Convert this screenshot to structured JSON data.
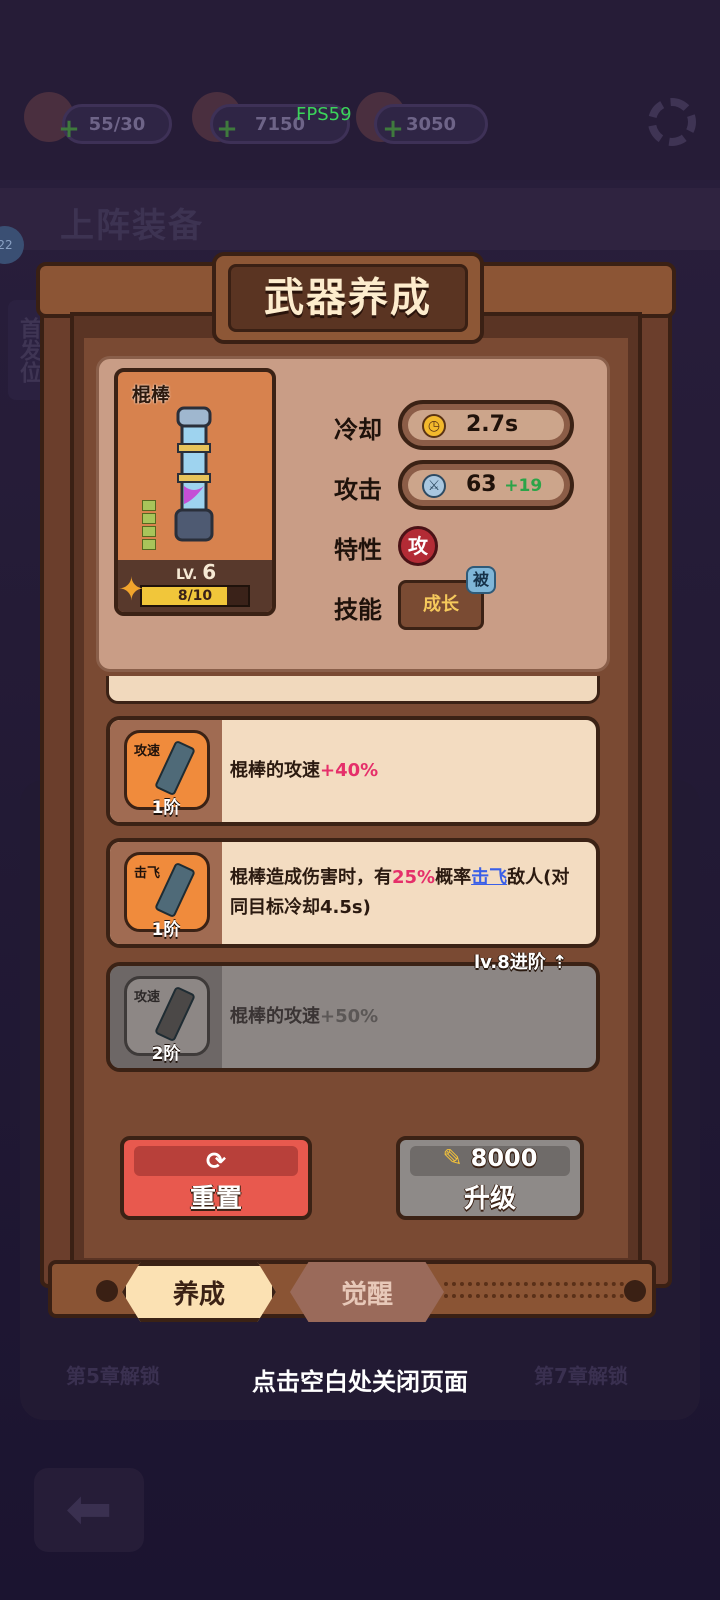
{
  "background": {
    "resources": [
      {
        "name": "energy",
        "value": "55/30"
      },
      {
        "name": "gold",
        "value": "7150"
      },
      {
        "name": "gem",
        "value": "3050"
      }
    ],
    "fps": "FPS59",
    "section_title": "上阵装备",
    "avatar_level": "22",
    "side_tag": "首发位",
    "chapters": [
      "第5章解锁",
      "第7章解锁"
    ]
  },
  "dialog": {
    "title": "武器养成",
    "weapon": {
      "name": "棍棒",
      "level_prefix": "LV.",
      "level": "6",
      "fragments": "8/10",
      "fragment_progress": 0.8
    },
    "stats": {
      "cooldown_label": "冷却",
      "cooldown_value": "2.7s",
      "attack_label": "攻击",
      "attack_value": "63",
      "attack_bonus": "+19",
      "trait_label": "特性",
      "trait_value": "攻",
      "skill_label": "技能",
      "skill_value": "成长",
      "skill_badge": "被"
    },
    "abilities": [
      {
        "tag": "攻速",
        "tier": "1阶",
        "text_pre": "棍棒的攻速",
        "text_val": "+40%",
        "locked": false
      },
      {
        "tag": "击飞",
        "tier": "1阶",
        "text_a": "棍棒造成伤害时，有",
        "text_pct": "25%",
        "text_b": "概率",
        "text_link": "击飞",
        "text_c": "敌人(对同目标冷却4.5s)",
        "locked": false
      },
      {
        "tag": "攻速",
        "tier": "2阶",
        "text_pre": "棍棒的攻速",
        "text_val": "+50%",
        "locked": true,
        "unlock_label": "lv.8进阶"
      }
    ],
    "buttons": {
      "reset_label": "重置",
      "upgrade_label": "升级",
      "upgrade_cost": "8000"
    },
    "tabs": [
      "养成",
      "觉醒"
    ],
    "close_hint": "点击空白处关闭页面"
  },
  "colors": {
    "highlight": "#e52f6a",
    "link": "#3a5fe8",
    "bonus": "#2ba448"
  }
}
